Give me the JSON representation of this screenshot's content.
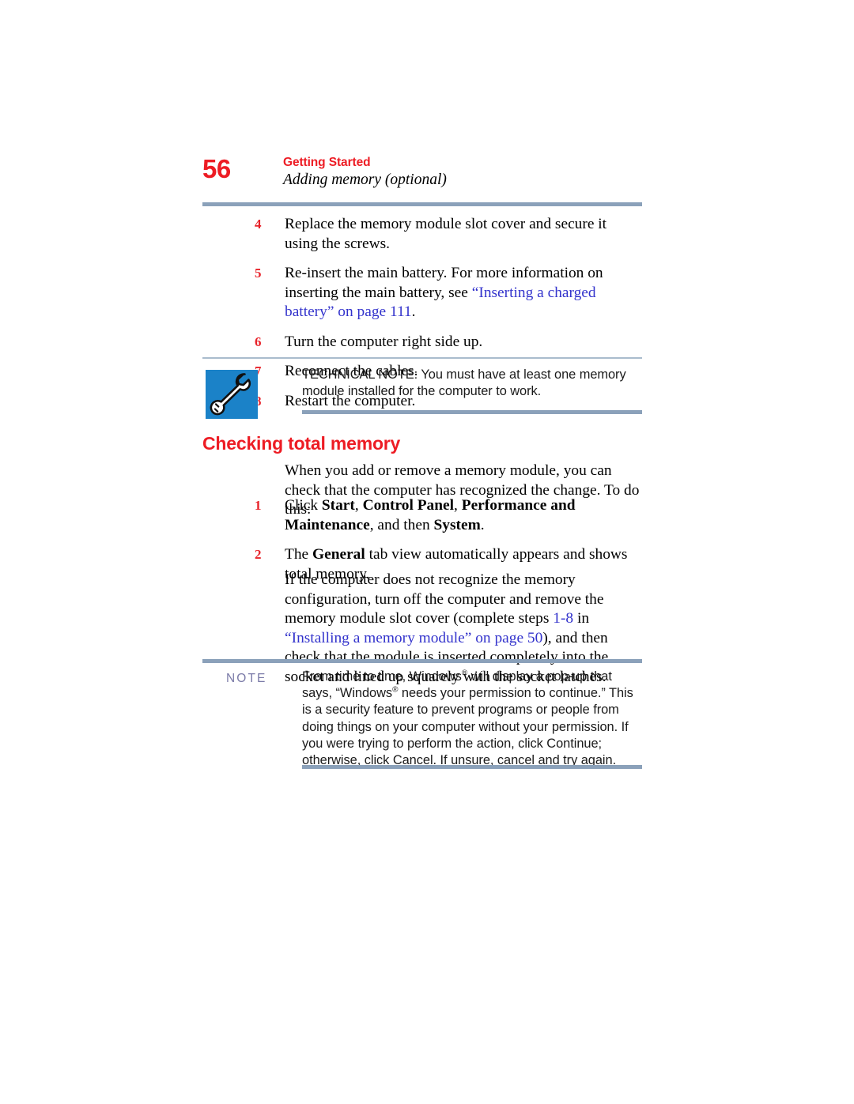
{
  "page": {
    "folio": "56",
    "chapter": "Getting Started",
    "section": "Adding memory (optional)"
  },
  "colors": {
    "accent_red": "#ed1c24",
    "link_blue": "#3333cc",
    "rule_blue": "#8ba1ba",
    "icon_blue": "#1b82c8",
    "note_label": "#7b7ba8"
  },
  "steps_group_1": [
    {
      "number": "4",
      "text_parts": [
        {
          "type": "text",
          "value": "Replace the memory module slot cover and secure it using the screws."
        }
      ]
    },
    {
      "number": "5",
      "text_parts": [
        {
          "type": "text",
          "value": "Re-insert the main battery. For more information on inserting the main battery, see "
        },
        {
          "type": "link",
          "value": "“Inserting a charged battery” on page 111"
        },
        {
          "type": "text",
          "value": "."
        }
      ]
    },
    {
      "number": "6",
      "text_parts": [
        {
          "type": "text",
          "value": "Turn the computer right side up."
        }
      ]
    },
    {
      "number": "7",
      "text_parts": [
        {
          "type": "text",
          "value": "Reconnect the cables."
        }
      ]
    },
    {
      "number": "8",
      "text_parts": [
        {
          "type": "text",
          "value": "Restart the computer."
        }
      ]
    }
  ],
  "technical_note": {
    "icon": "wrench-icon",
    "text_parts": [
      {
        "type": "text",
        "value": "TECHNICAL NOTE: You must have at least one memory module installed for the computer to work."
      }
    ]
  },
  "section_heading": "Checking total memory",
  "intro_paragraph": "When you add or remove a memory module, you can check that the computer has recognized the change. To do this:",
  "steps_group_2": [
    {
      "number": "1",
      "text_parts": [
        {
          "type": "text",
          "value": "Click "
        },
        {
          "type": "bold",
          "value": "Start"
        },
        {
          "type": "text",
          "value": ", "
        },
        {
          "type": "bold",
          "value": "Control Panel"
        },
        {
          "type": "text",
          "value": ", "
        },
        {
          "type": "bold",
          "value": "Performance and Maintenance"
        },
        {
          "type": "text",
          "value": ", and then "
        },
        {
          "type": "bold",
          "value": "System"
        },
        {
          "type": "text",
          "value": "."
        }
      ]
    },
    {
      "number": "2",
      "text_parts": [
        {
          "type": "text",
          "value": "The "
        },
        {
          "type": "bold",
          "value": "General"
        },
        {
          "type": "text",
          "value": " tab view automatically appears and shows total memory."
        }
      ]
    }
  ],
  "closing_paragraph": {
    "text_parts": [
      {
        "type": "text",
        "value": "If the computer does not recognize the memory configuration, turn off the computer and remove the memory module slot cover (complete steps "
      },
      {
        "type": "link",
        "value": "1-8"
      },
      {
        "type": "text",
        "value": " in "
      },
      {
        "type": "link",
        "value": "“Installing a memory module” on page 50"
      },
      {
        "type": "text",
        "value": "), and then check that the module is inserted completely into the socket and lined up squarely with the socket latches."
      }
    ]
  },
  "note": {
    "label": "NOTE",
    "text_parts": [
      {
        "type": "text",
        "value": "From time to time, Windows"
      },
      {
        "type": "sup",
        "value": "®"
      },
      {
        "type": "text",
        "value": " will display a pop-up that says, “Windows"
      },
      {
        "type": "sup",
        "value": "®"
      },
      {
        "type": "text",
        "value": " needs your permission to continue.” This is a security feature to prevent programs or people from doing things on your computer without your permission. If you were trying to perform the action, click Continue; otherwise, click Cancel. If unsure, cancel and try again."
      }
    ]
  }
}
